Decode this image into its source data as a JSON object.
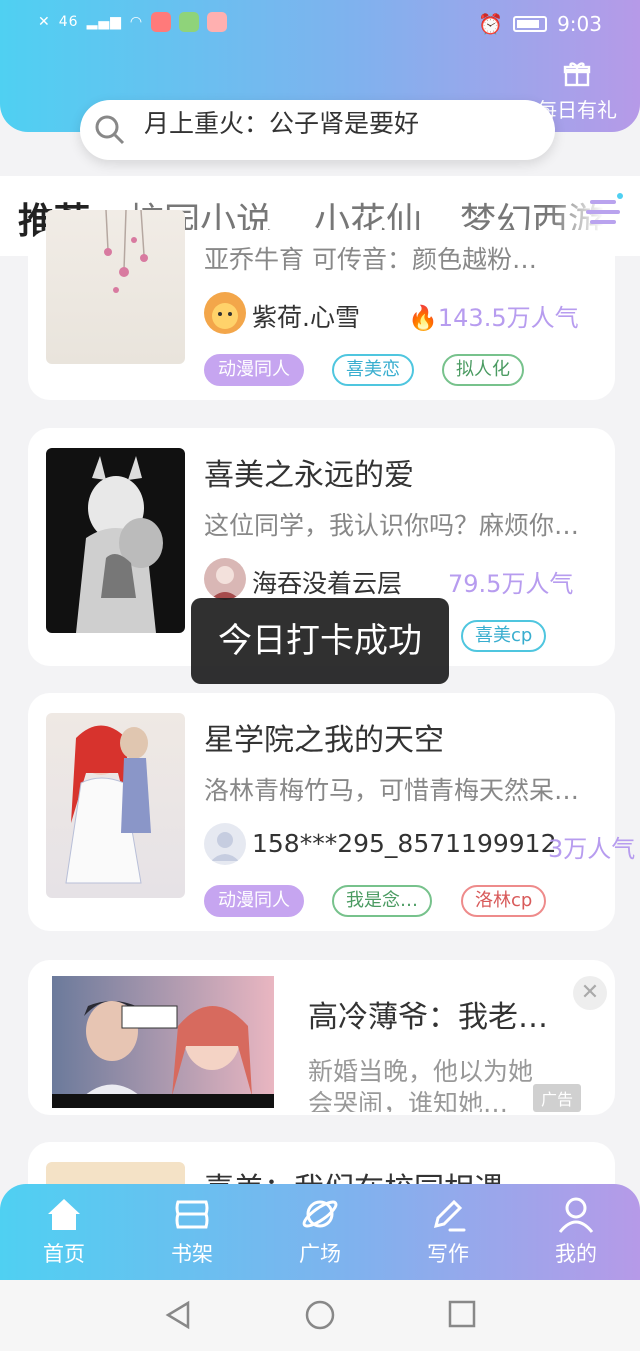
{
  "status_bar": {
    "time": "9:03",
    "signal": "46",
    "colors": {
      "header_start": "#4fd0f2",
      "header_end": "#b69ae8"
    }
  },
  "header": {
    "gift_label": "每日有礼",
    "search_text": "月上重火：公子肾是要好"
  },
  "tabs": [
    {
      "label": "推荐",
      "active": true
    },
    {
      "label": "校园小说"
    },
    {
      "label": "小花仙"
    },
    {
      "label": "梦幻西游"
    }
  ],
  "cards": [
    {
      "desc": "亚乔牛育 可传音：颜色越粉…",
      "author": "紫荷.心雪",
      "popularity": "143.5万人气",
      "tags": [
        "动漫同人",
        "喜美恋",
        "拟人化"
      ]
    },
    {
      "title": "喜美之永远的爱",
      "desc": "这位同学，我认识你吗？麻烦你…",
      "author": "海吞没着云层",
      "popularity": "79.5万人气",
      "tags": [
        "喜美cp"
      ]
    },
    {
      "title": "星学院之我的天空",
      "desc": "洛林青梅竹马，可惜青梅天然呆…",
      "author": "158***295_8571199912",
      "popularity": "3万人气",
      "tags": [
        "动漫同人",
        "我是念…",
        "洛林cp"
      ]
    }
  ],
  "ad": {
    "title": "高冷薄爷：我老…",
    "desc_line1": "新婚当晚，他以为她",
    "desc_line2": "会哭闹，谁知她…",
    "ad_label": "广告"
  },
  "partial_card": {
    "title": "喜美：我们在校园相遇"
  },
  "toast": "今日打卡成功",
  "bottom_nav": [
    {
      "label": "首页",
      "icon": "home-icon"
    },
    {
      "label": "书架",
      "icon": "bookshelf-icon"
    },
    {
      "label": "广场",
      "icon": "planet-icon"
    },
    {
      "label": "写作",
      "icon": "pen-icon"
    },
    {
      "label": "我的",
      "icon": "user-icon"
    }
  ]
}
